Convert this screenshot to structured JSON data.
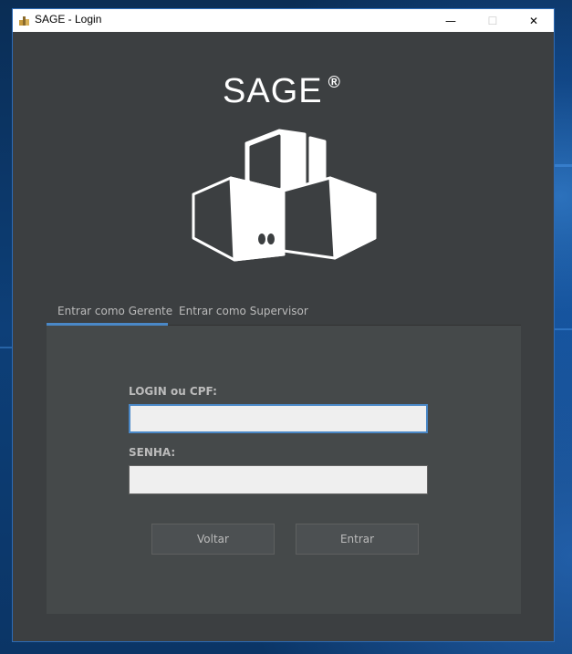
{
  "window": {
    "title": "SAGE - Login",
    "app_icon": "sage-app-icon",
    "controls": {
      "minimize_glyph": "—",
      "maximize_glyph": "☐",
      "close_glyph": "✕"
    }
  },
  "brand": {
    "name": "SAGE",
    "mark": "®",
    "logo": "building-logo"
  },
  "tabs": [
    {
      "label": "Entrar como Gerente",
      "selected": true
    },
    {
      "label": "Entrar como Supervisor",
      "selected": false
    }
  ],
  "form": {
    "login_label": "LOGIN ou CPF:",
    "login_value": "",
    "password_label": "SENHA:",
    "password_value": ""
  },
  "buttons": {
    "back_label": "Voltar",
    "submit_label": "Entrar"
  },
  "colors": {
    "window_bg": "#3c3f41",
    "panel_bg": "#45494a",
    "accent": "#4a88c7",
    "text": "#bbbbbb"
  }
}
